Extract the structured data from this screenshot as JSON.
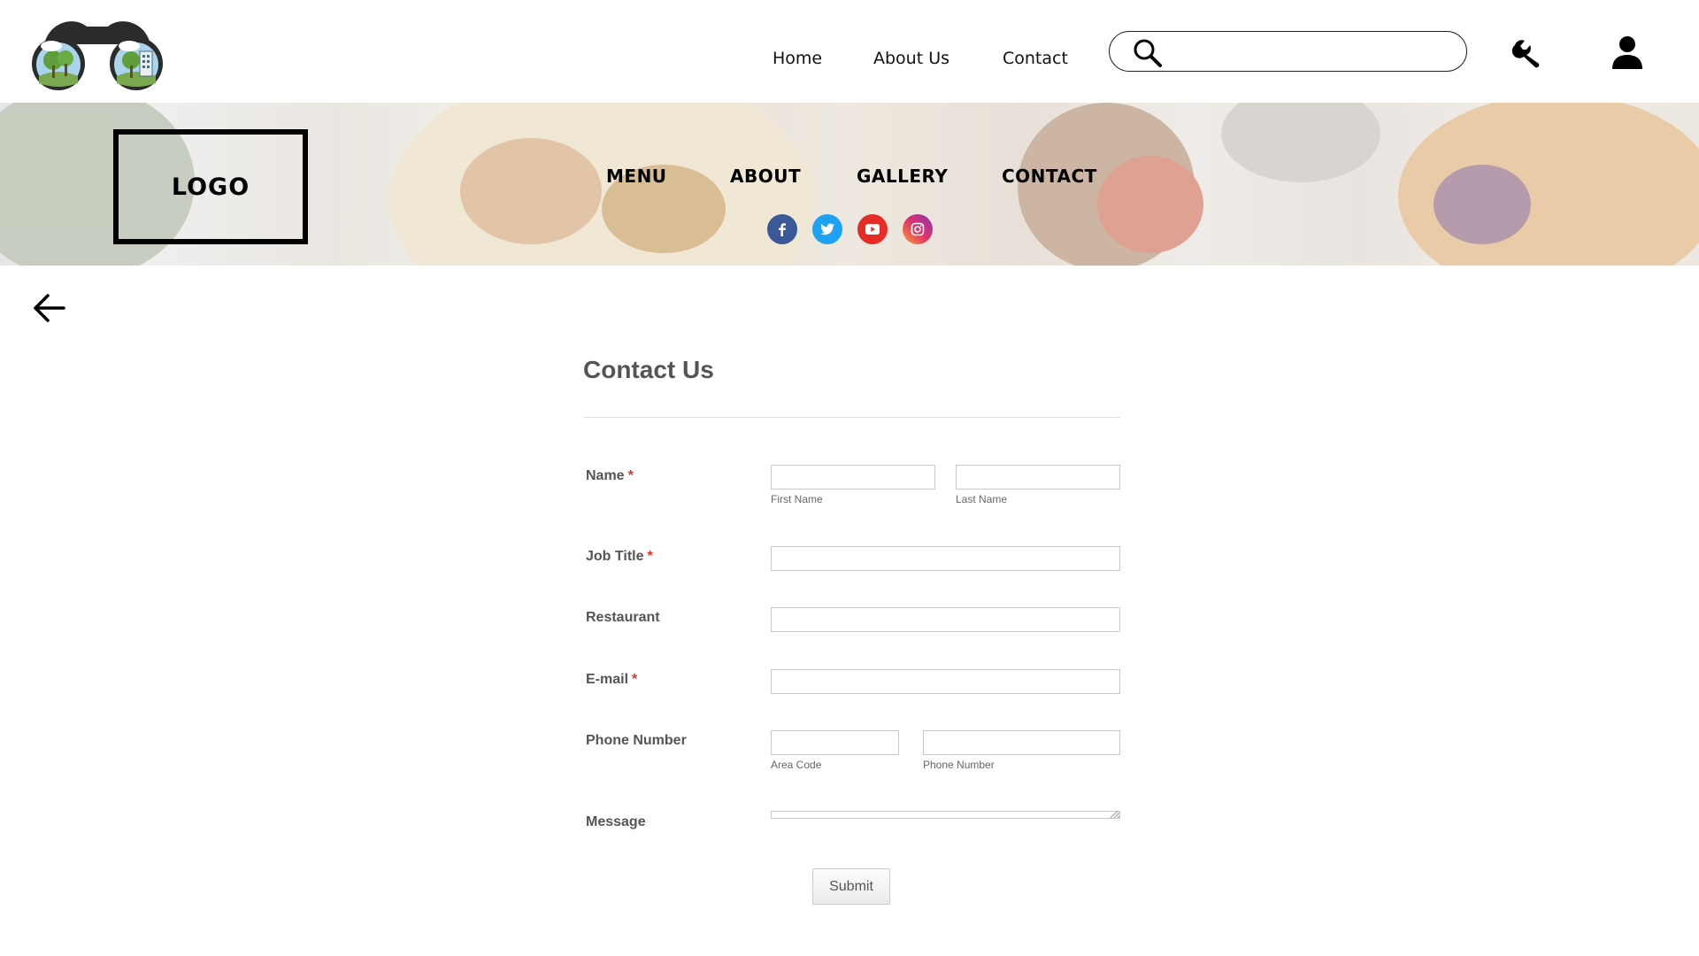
{
  "top_nav": {
    "home": "Home",
    "about": "About Us",
    "contact": "Contact"
  },
  "search": {
    "value": "",
    "placeholder": ""
  },
  "hero": {
    "logo_text": "LOGO",
    "nav": {
      "menu": "MENU",
      "about": "ABOUT",
      "gallery": "GALLERY",
      "contact": "CONTACT"
    },
    "social": [
      {
        "icon": "facebook-icon",
        "color": "#3b5998"
      },
      {
        "icon": "twitter-icon",
        "color": "#1da1f2"
      },
      {
        "icon": "youtube-icon",
        "color": "#e52d27"
      },
      {
        "icon": "instagram-icon",
        "color": "#c13584"
      }
    ]
  },
  "form": {
    "title": "Contact Us",
    "labels": {
      "name": "Name",
      "job_title": "Job Title",
      "restaurant": "Restaurant",
      "email": "E-mail",
      "phone": "Phone Number",
      "message": "Message"
    },
    "required_mark": "*",
    "sub_labels": {
      "first_name": "First Name",
      "last_name": "Last Name",
      "area_code": "Area Code",
      "phone_number": "Phone Number"
    },
    "values": {
      "first_name": "",
      "last_name": "",
      "job_title": "",
      "restaurant": "",
      "email": "",
      "area_code": "",
      "phone_number": "",
      "message": ""
    },
    "submit_label": "Submit"
  },
  "colors": {
    "required": "#e0322b",
    "label": "#555555",
    "border": "#c8c8c8"
  }
}
